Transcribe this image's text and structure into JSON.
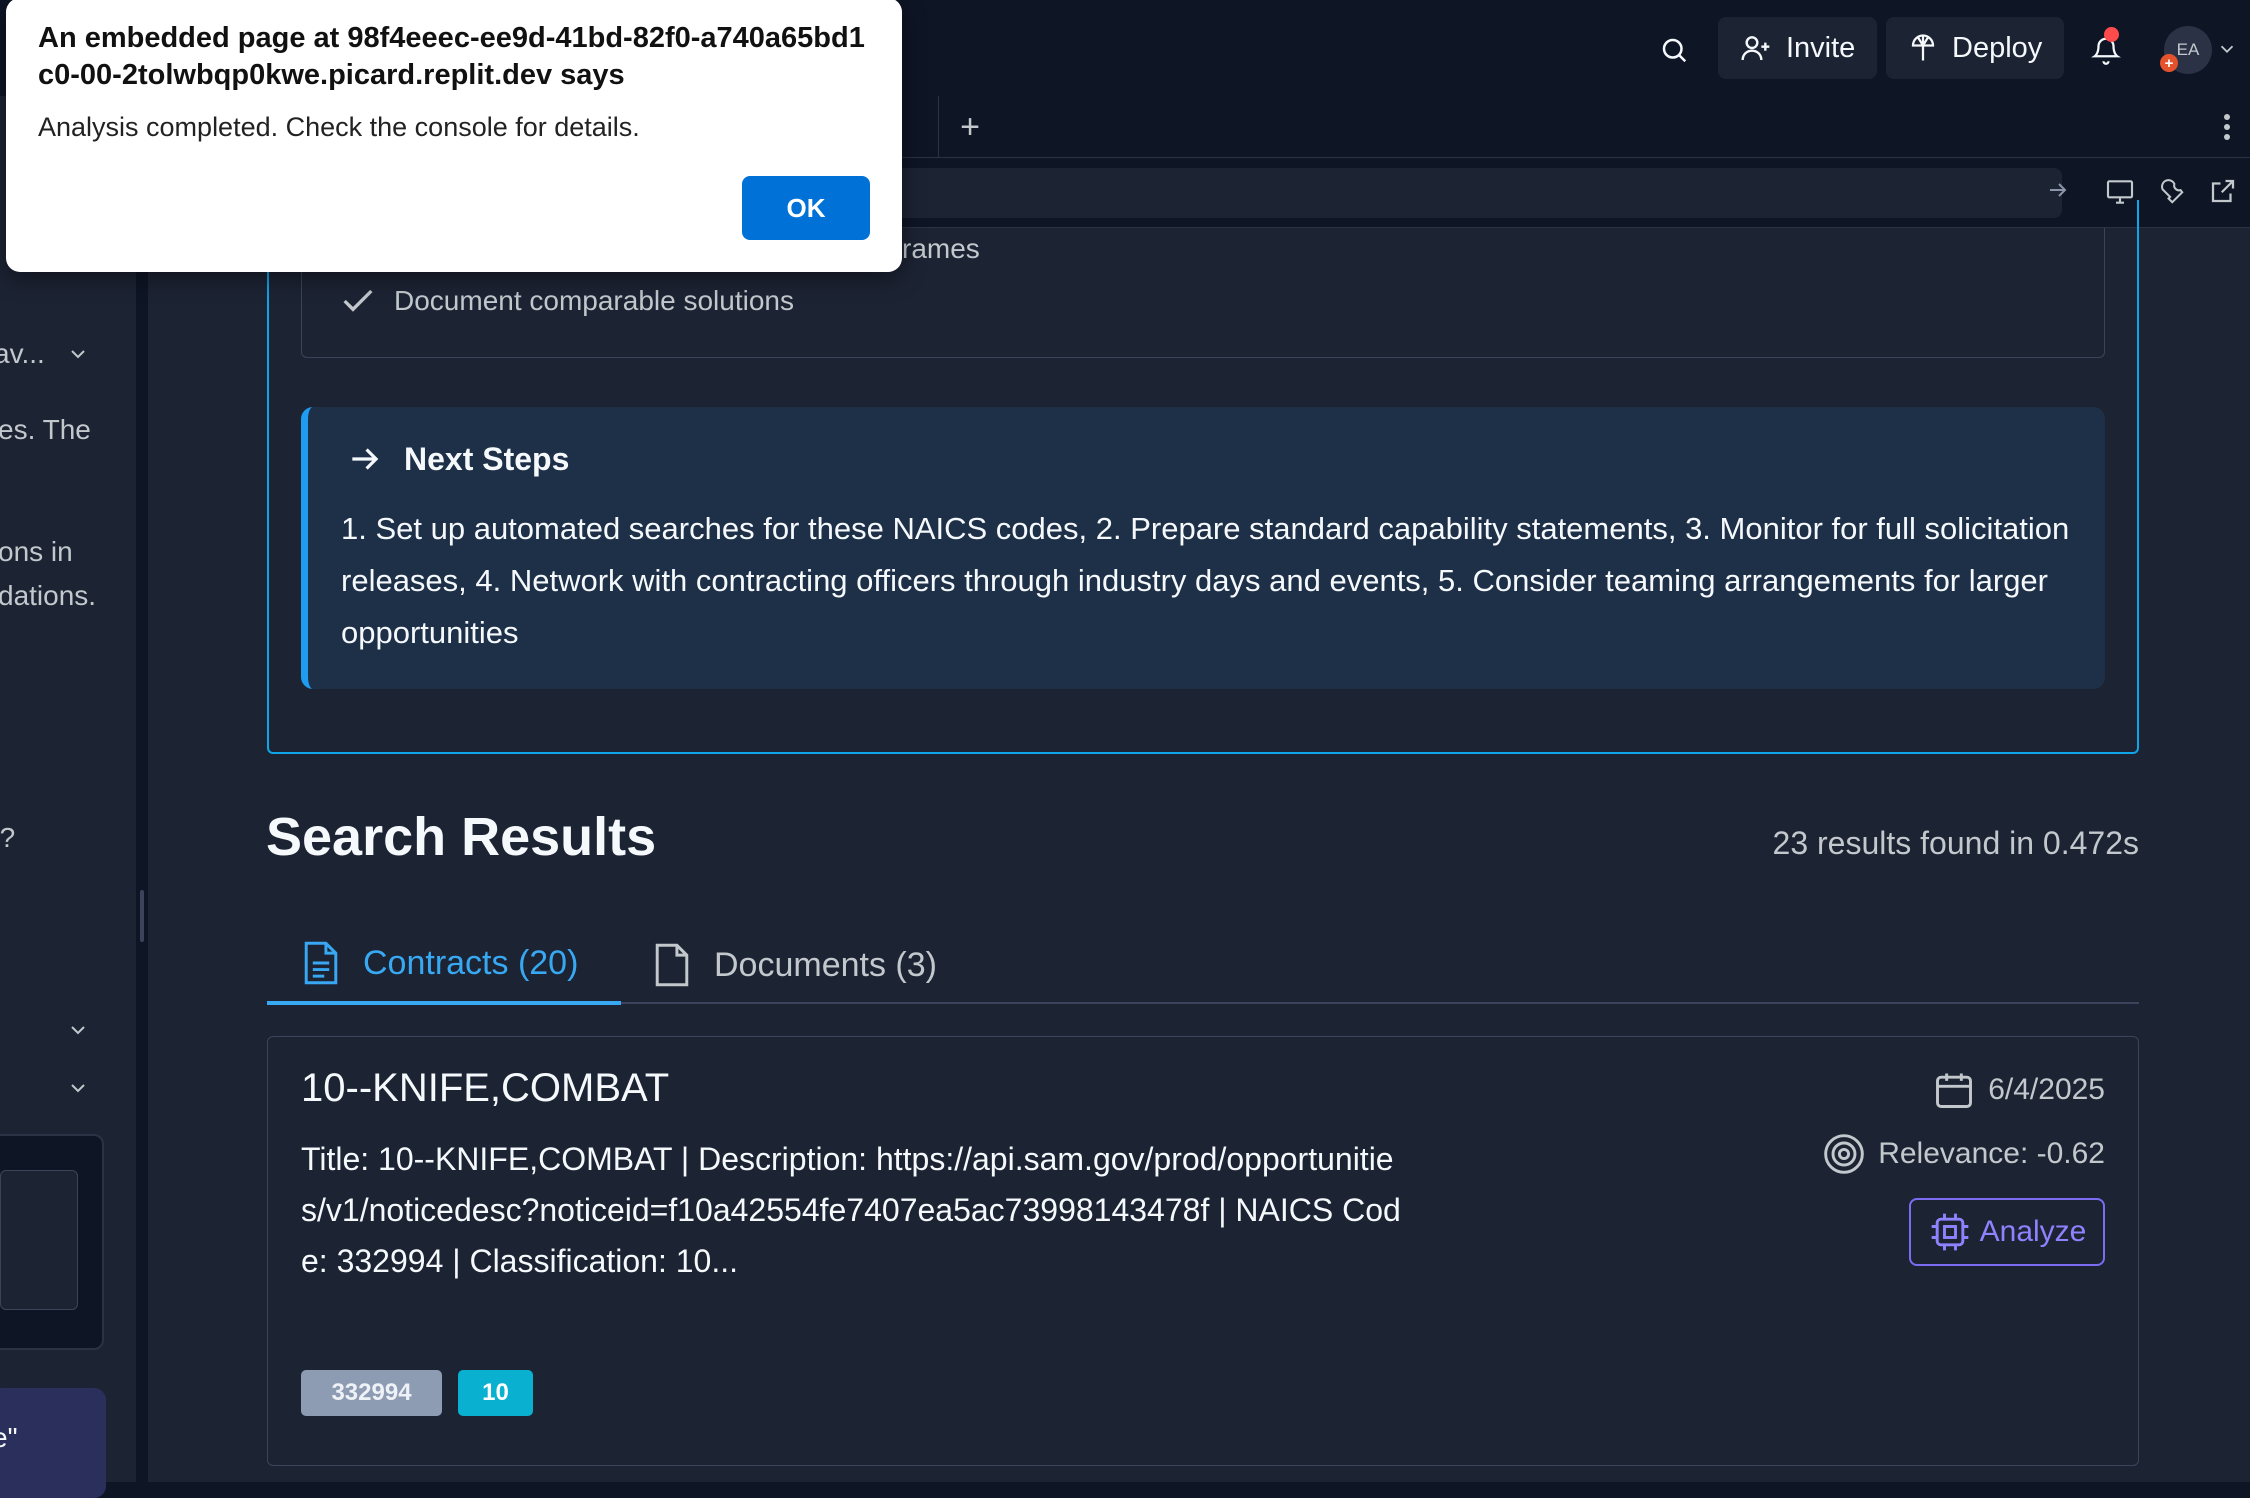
{
  "topbar": {
    "invite_label": "Invite",
    "deploy_label": "Deploy",
    "avatar_initials": "EA",
    "avatar_plus": "+"
  },
  "tabs_bar": {
    "add_label": "+"
  },
  "sidebar": {
    "text_lines": [
      "av...",
      "es. The",
      "ons in",
      "dations.",
      "e?"
    ],
    "chat_snippet": "e\""
  },
  "checklist": {
    "partial_item": "rames",
    "item": "Document comparable solutions"
  },
  "next_steps": {
    "title": "Next Steps",
    "body": "1. Set up automated searches for these NAICS codes, 2. Prepare standard capability statements, 3. Monitor for full solicitation releases, 4. Network with contracting officers through industry days and events, 5. Consider teaming arrangements for larger opportunities"
  },
  "results": {
    "title": "Search Results",
    "count_text": "23 results found in 0.472s",
    "tabs": [
      {
        "label": "Contracts (20)",
        "active": true
      },
      {
        "label": "Documents (3)",
        "active": false
      }
    ]
  },
  "result_card": {
    "title": "10--KNIFE,COMBAT",
    "description": "Title: 10--KNIFE,COMBAT | Description: https://api.sam.gov/prod/opportunities/v1/noticedesc?noticeid=f10a42554fe7407ea5ac73998143478f | NAICS Code: 332994 | Classification: 10...",
    "date": "6/4/2025",
    "relevance": "Relevance: -0.62",
    "analyze_label": "Analyze",
    "tags": [
      "332994",
      "10"
    ]
  },
  "dialog": {
    "title": "An embedded page at 98f4eeec-ee9d-41bd-82f0-a740a65bd1c0-00-2tolwbqp0kwe.picard.replit.dev says",
    "message": "Analysis completed. Check the console for details.",
    "ok_label": "OK"
  },
  "colors": {
    "background": "#0e1525",
    "panel": "#1c2333",
    "accent_blue": "#38a8f2",
    "card_border": "#0ea5e9",
    "analyze_purple": "#8f82ff",
    "tag_naics": "#8d9bb3",
    "tag_class": "#0ab0cf",
    "dialog_ok": "#0071d7"
  }
}
